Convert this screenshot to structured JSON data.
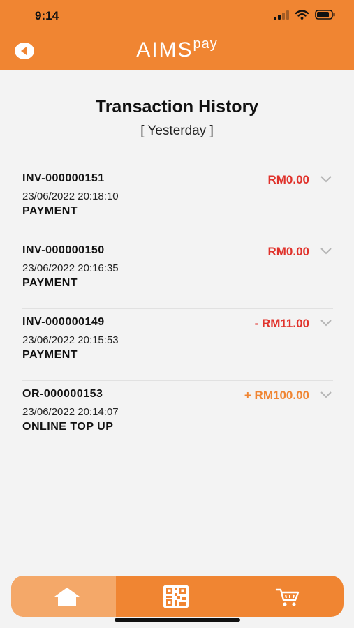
{
  "status_bar": {
    "time": "9:14"
  },
  "header": {
    "brand_main": "AIMS",
    "brand_sup": "pay",
    "colors": {
      "background": "#f08532",
      "foreground": "#ffffff"
    }
  },
  "page": {
    "title": "Transaction History",
    "period": "[ Yesterday ]"
  },
  "transactions": [
    {
      "ref": "INV-000000151",
      "datetime": "23/06/2022 20:18:10",
      "type": "PAYMENT",
      "amount": "RM0.00",
      "amount_color": "#e0322b"
    },
    {
      "ref": "INV-000000150",
      "datetime": "23/06/2022 20:16:35",
      "type": "PAYMENT",
      "amount": "RM0.00",
      "amount_color": "#e0322b"
    },
    {
      "ref": "INV-000000149",
      "datetime": "23/06/2022 20:15:53",
      "type": "PAYMENT",
      "amount": "- RM11.00",
      "amount_color": "#e0322b"
    },
    {
      "ref": "OR-000000153",
      "datetime": "23/06/2022 20:14:07",
      "type": "ONLINE TOP UP",
      "amount": "+ RM100.00",
      "amount_color": "#f08532"
    }
  ],
  "bottom_nav": {
    "items": [
      {
        "icon": "home-icon",
        "active": true
      },
      {
        "icon": "qr-code-icon",
        "active": false
      },
      {
        "icon": "cart-icon",
        "active": false
      }
    ]
  }
}
